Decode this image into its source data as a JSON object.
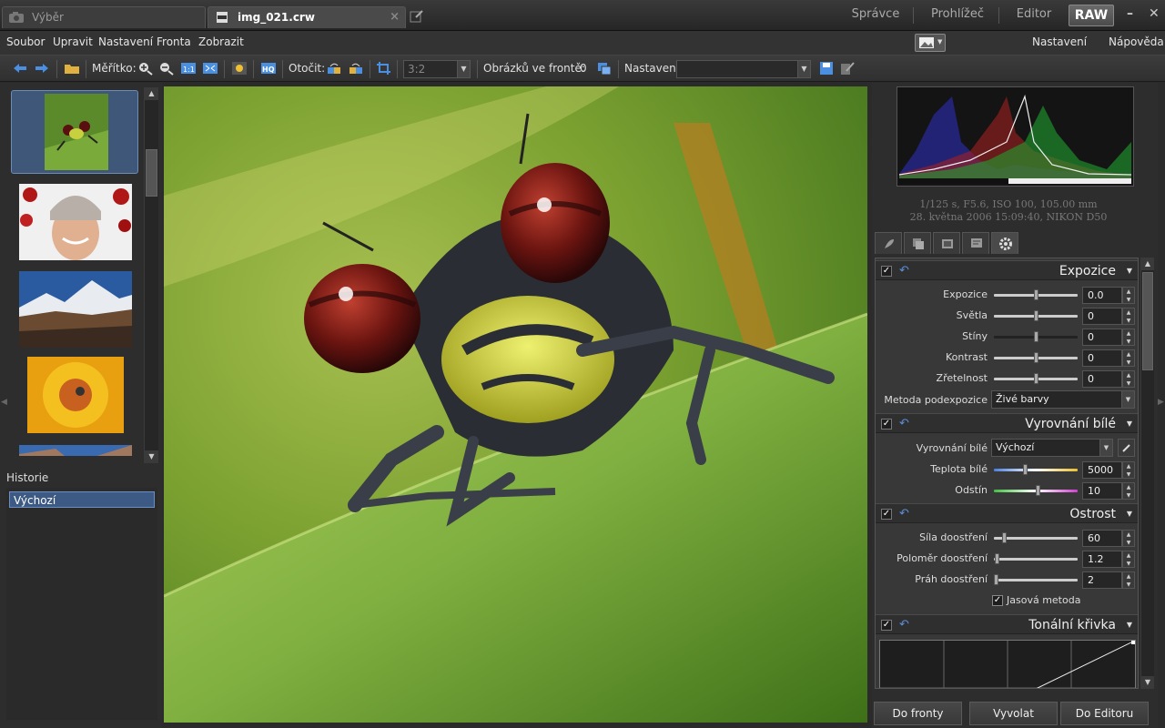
{
  "tabs": {
    "selection": "Výběr",
    "file": "img_021.crw",
    "close": "×"
  },
  "modes": {
    "manager": "Správce",
    "viewer": "Prohlížeč",
    "editor": "Editor",
    "raw": "RAW"
  },
  "window": {
    "minimize": "–",
    "close": "✕"
  },
  "menu": {
    "file": "Soubor",
    "edit": "Upravit",
    "settings": "Nastavení",
    "queue": "Fronta",
    "view": "Zobrazit",
    "settings_btn": "Nastavení",
    "help_btn": "Nápověda"
  },
  "toolbar": {
    "scale_label": "Měřítko:",
    "rotate_label": "Otočit:",
    "ratio_value": "3:2",
    "queue_label": "Obrázků ve frontě:",
    "queue_count": "0",
    "preset_label": "Nastavení:",
    "preset_value": ""
  },
  "history": {
    "label": "Historie",
    "items": [
      "Výchozí"
    ]
  },
  "exif": {
    "line1": "1/125 s, F5.6, ISO 100, 105.00 mm",
    "line2": "28. května 2006 15:09:40, NIKON D50"
  },
  "exposure": {
    "title": "Expozice",
    "rows": [
      {
        "label": "Expozice",
        "value": "0.0"
      },
      {
        "label": "Světla",
        "value": "0"
      },
      {
        "label": "Stíny",
        "value": "0"
      },
      {
        "label": "Kontrast",
        "value": "0"
      },
      {
        "label": "Zřetelnost",
        "value": "0"
      }
    ],
    "method_label": "Metoda podexpozice",
    "method_value": "Živé barvy"
  },
  "white_balance": {
    "title": "Vyrovnání bílé",
    "wb_label": "Vyrovnání bílé",
    "wb_value": "Výchozí",
    "temp_label": "Teplota bílé",
    "temp_value": "5000",
    "tint_label": "Odstín",
    "tint_value": "10"
  },
  "sharpen": {
    "title": "Ostrost",
    "amount_label": "Síla doostření",
    "amount_value": "60",
    "radius_label": "Poloměr doostření",
    "radius_value": "1.2",
    "threshold_label": "Práh doostření",
    "threshold_value": "2",
    "luma_label": "Jasová metoda"
  },
  "curve": {
    "title": "Tonální křivka"
  },
  "buttons": {
    "to_queue": "Do fronty",
    "export": "Vyvolat",
    "to_editor": "Do Editoru"
  },
  "colors": {
    "accent": "#5b8fd6",
    "selection": "#3d5a84",
    "background": "#2d2d2d"
  }
}
